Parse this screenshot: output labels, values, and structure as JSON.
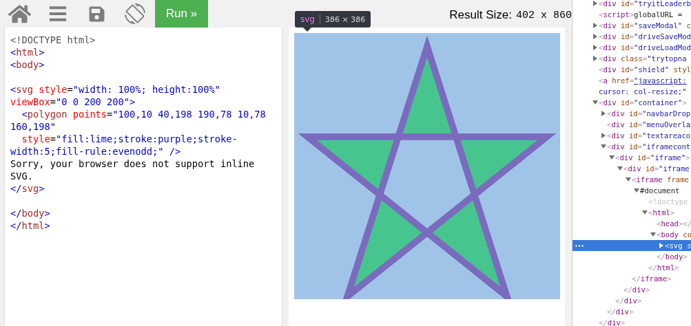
{
  "toolbar": {
    "run_button": "Run »",
    "result_size_label": "Result Size:",
    "result_size_value": "402 x 860"
  },
  "editor": {
    "lines": [
      {
        "kind": "code",
        "tokens": [
          {
            "kind": "doctype",
            "text": "<!DOCTYPE html>"
          }
        ]
      },
      {
        "kind": "code",
        "tokens": [
          {
            "kind": "punct",
            "text": "<"
          },
          {
            "kind": "tag",
            "text": "html"
          },
          {
            "kind": "punct",
            "text": ">"
          }
        ]
      },
      {
        "kind": "code",
        "tokens": [
          {
            "kind": "punct",
            "text": "<"
          },
          {
            "kind": "tag",
            "text": "body"
          },
          {
            "kind": "punct",
            "text": ">"
          }
        ]
      },
      {
        "kind": "blank"
      },
      {
        "kind": "code",
        "tokens": [
          {
            "kind": "punct",
            "text": "<"
          },
          {
            "kind": "tag",
            "text": "svg"
          },
          {
            "kind": "attr",
            "text": " style"
          },
          {
            "kind": "text",
            "text": "="
          },
          {
            "kind": "value",
            "text": "\"width: 100%; height:100%\""
          }
        ]
      },
      {
        "kind": "code",
        "tokens": [
          {
            "kind": "attr",
            "text": "viewBox"
          },
          {
            "kind": "text",
            "text": "="
          },
          {
            "kind": "value",
            "text": "\"0 0 200 200\""
          },
          {
            "kind": "punct",
            "text": ">"
          }
        ]
      },
      {
        "kind": "code",
        "tokens": [
          {
            "kind": "punct",
            "text": "  <"
          },
          {
            "kind": "tag",
            "text": "polygon"
          },
          {
            "kind": "attr",
            "text": " points"
          },
          {
            "kind": "text",
            "text": "="
          },
          {
            "kind": "value",
            "text": "\"100,10 40,198 190,78 10,78"
          }
        ]
      },
      {
        "kind": "code",
        "tokens": [
          {
            "kind": "value",
            "text": "160,198\""
          }
        ]
      },
      {
        "kind": "code",
        "tokens": [
          {
            "kind": "attr",
            "text": "  style"
          },
          {
            "kind": "text",
            "text": "="
          },
          {
            "kind": "value",
            "text": "\"fill:lime;stroke:purple;stroke-"
          }
        ]
      },
      {
        "kind": "code",
        "tokens": [
          {
            "kind": "value",
            "text": "width:5;fill-rule:evenodd;\""
          },
          {
            "kind": "punct",
            "text": " />"
          }
        ]
      },
      {
        "kind": "code",
        "tokens": [
          {
            "kind": "text",
            "text": "Sorry, your browser does not support inline"
          }
        ]
      },
      {
        "kind": "code",
        "tokens": [
          {
            "kind": "text",
            "text": "SVG."
          }
        ]
      },
      {
        "kind": "code",
        "tokens": [
          {
            "kind": "punct",
            "text": "</"
          },
          {
            "kind": "tag",
            "text": "svg"
          },
          {
            "kind": "punct",
            "text": ">"
          }
        ]
      },
      {
        "kind": "blank"
      },
      {
        "kind": "code",
        "tokens": [
          {
            "kind": "punct",
            "text": "</"
          },
          {
            "kind": "tag",
            "text": "body"
          },
          {
            "kind": "punct",
            "text": ">"
          }
        ]
      },
      {
        "kind": "code",
        "tokens": [
          {
            "kind": "punct",
            "text": "</"
          },
          {
            "kind": "tag",
            "text": "html"
          },
          {
            "kind": "punct",
            "text": ">"
          }
        ]
      }
    ]
  },
  "tooltip": {
    "tag": "svg",
    "size": "386 × 386"
  },
  "devtools": {
    "nodes": [
      {
        "selected": false,
        "expanded": false,
        "tokens": [
          {
            "kind": "punct",
            "text": "<"
          },
          {
            "kind": "tag",
            "text": "div"
          },
          {
            "kind": "attr",
            "text": " id"
          },
          {
            "kind": "punct",
            "text": "="
          },
          {
            "kind": "value",
            "text": "\"tryitLeaderb"
          }
        ]
      },
      {
        "selected": false,
        "tokens": [
          {
            "kind": "punct",
            "text": "<"
          },
          {
            "kind": "tag",
            "text": "script"
          },
          {
            "kind": "punct",
            "text": ">"
          },
          {
            "kind": "text",
            "text": "globalURL ="
          }
        ]
      },
      {
        "selected": false,
        "expanded": false,
        "tokens": [
          {
            "kind": "punct",
            "text": "<"
          },
          {
            "kind": "tag",
            "text": "div"
          },
          {
            "kind": "attr",
            "text": " id"
          },
          {
            "kind": "punct",
            "text": "="
          },
          {
            "kind": "value",
            "text": "\"saveModal\""
          },
          {
            "kind": "attr",
            "text": " c"
          }
        ]
      },
      {
        "selected": false,
        "expanded": false,
        "tokens": [
          {
            "kind": "punct",
            "text": "<"
          },
          {
            "kind": "tag",
            "text": "div"
          },
          {
            "kind": "attr",
            "text": " id"
          },
          {
            "kind": "punct",
            "text": "="
          },
          {
            "kind": "value",
            "text": "\"driveSaveMod"
          }
        ]
      },
      {
        "selected": false,
        "expanded": false,
        "tokens": [
          {
            "kind": "punct",
            "text": "<"
          },
          {
            "kind": "tag",
            "text": "div"
          },
          {
            "kind": "attr",
            "text": " id"
          },
          {
            "kind": "punct",
            "text": "="
          },
          {
            "kind": "value",
            "text": "\"driveLoadMod"
          }
        ]
      },
      {
        "selected": false,
        "expanded": false,
        "tokens": [
          {
            "kind": "punct",
            "text": "<"
          },
          {
            "kind": "tag",
            "text": "div"
          },
          {
            "kind": "attr",
            "text": " class"
          },
          {
            "kind": "punct",
            "text": "="
          },
          {
            "kind": "value",
            "text": "\"trytopna"
          }
        ]
      },
      {
        "selected": false,
        "tokens": [
          {
            "kind": "punct",
            "text": "<"
          },
          {
            "kind": "tag",
            "text": "div"
          },
          {
            "kind": "attr",
            "text": " id"
          },
          {
            "kind": "punct",
            "text": "="
          },
          {
            "kind": "value",
            "text": "\"shield\""
          },
          {
            "kind": "attr",
            "text": " styl"
          }
        ]
      },
      {
        "selected": false,
        "tokens": [
          {
            "kind": "punct",
            "text": "<"
          },
          {
            "kind": "tag",
            "text": "a"
          },
          {
            "kind": "attr",
            "text": " href"
          },
          {
            "kind": "punct",
            "text": "="
          },
          {
            "kind": "link",
            "text": "\"javascript:"
          }
        ]
      },
      {
        "selected": false,
        "tokens": [
          {
            "kind": "value",
            "text": "cursor: col-resize;\""
          }
        ]
      },
      {
        "selected": false,
        "expanded": true,
        "tokens": [
          {
            "kind": "punct",
            "text": "<"
          },
          {
            "kind": "tag",
            "text": "div"
          },
          {
            "kind": "attr",
            "text": " id"
          },
          {
            "kind": "punct",
            "text": "="
          },
          {
            "kind": "value",
            "text": "\"container\""
          },
          {
            "kind": "punct",
            "text": ">"
          }
        ],
        "close": [
          {
            "kind": "punct",
            "text": "</"
          },
          {
            "kind": "tag",
            "text": "div"
          },
          {
            "kind": "punct",
            "text": ">"
          }
        ],
        "children": [
          {
            "selected": false,
            "expanded": false,
            "tokens": [
              {
                "kind": "punct",
                "text": "<"
              },
              {
                "kind": "tag",
                "text": "div"
              },
              {
                "kind": "attr",
                "text": " id"
              },
              {
                "kind": "punct",
                "text": "="
              },
              {
                "kind": "value",
                "text": "\"navbarDrop"
              }
            ]
          },
          {
            "selected": false,
            "tokens": [
              {
                "kind": "punct",
                "text": "<"
              },
              {
                "kind": "tag",
                "text": "div"
              },
              {
                "kind": "attr",
                "text": " id"
              },
              {
                "kind": "punct",
                "text": "="
              },
              {
                "kind": "value",
                "text": "\"menuOverla"
              }
            ]
          },
          {
            "selected": false,
            "expanded": false,
            "tokens": [
              {
                "kind": "punct",
                "text": "<"
              },
              {
                "kind": "tag",
                "text": "div"
              },
              {
                "kind": "attr",
                "text": " id"
              },
              {
                "kind": "punct",
                "text": "="
              },
              {
                "kind": "value",
                "text": "\"textareaco"
              }
            ]
          },
          {
            "selected": false,
            "expanded": true,
            "tokens": [
              {
                "kind": "punct",
                "text": "<"
              },
              {
                "kind": "tag",
                "text": "div"
              },
              {
                "kind": "attr",
                "text": " id"
              },
              {
                "kind": "punct",
                "text": "="
              },
              {
                "kind": "value",
                "text": "\"iframecont"
              }
            ],
            "close": [
              {
                "kind": "punct",
                "text": "</"
              },
              {
                "kind": "tag",
                "text": "div"
              },
              {
                "kind": "punct",
                "text": ">"
              }
            ],
            "children": [
              {
                "selected": false,
                "expanded": true,
                "tokens": [
                  {
                    "kind": "punct",
                    "text": "<"
                  },
                  {
                    "kind": "tag",
                    "text": "div"
                  },
                  {
                    "kind": "attr",
                    "text": " id"
                  },
                  {
                    "kind": "punct",
                    "text": "="
                  },
                  {
                    "kind": "value",
                    "text": "\"iframe\""
                  },
                  {
                    "kind": "punct",
                    "text": ">"
                  }
                ],
                "close": [
                  {
                    "kind": "punct",
                    "text": "</"
                  },
                  {
                    "kind": "tag",
                    "text": "div"
                  },
                  {
                    "kind": "punct",
                    "text": ">"
                  }
                ],
                "children": [
                  {
                    "selected": false,
                    "expanded": true,
                    "tokens": [
                      {
                        "kind": "punct",
                        "text": "<"
                      },
                      {
                        "kind": "tag",
                        "text": "div"
                      },
                      {
                        "kind": "attr",
                        "text": " id"
                      },
                      {
                        "kind": "punct",
                        "text": "="
                      },
                      {
                        "kind": "value",
                        "text": "\"iframe"
                      }
                    ],
                    "close": [
                      {
                        "kind": "punct",
                        "text": "</"
                      },
                      {
                        "kind": "tag",
                        "text": "div"
                      },
                      {
                        "kind": "punct",
                        "text": ">"
                      }
                    ],
                    "children": [
                      {
                        "selected": false,
                        "expanded": true,
                        "tokens": [
                          {
                            "kind": "punct",
                            "text": "<"
                          },
                          {
                            "kind": "tag",
                            "text": "iframe"
                          },
                          {
                            "kind": "attr",
                            "text": " frame"
                          }
                        ],
                        "close": [
                          {
                            "kind": "punct",
                            "text": "</"
                          },
                          {
                            "kind": "tag",
                            "text": "iframe"
                          },
                          {
                            "kind": "punct",
                            "text": ">"
                          }
                        ],
                        "children": [
                          {
                            "selected": false,
                            "expanded": true,
                            "tokens": [
                              {
                                "kind": "text",
                                "text": "#document"
                              }
                            ],
                            "children": [
                              {
                                "selected": false,
                                "tokens": [
                                  {
                                    "kind": "doctype",
                                    "text": "<!doctype"
                                  }
                                ]
                              },
                              {
                                "selected": false,
                                "expanded": true,
                                "tokens": [
                                  {
                                    "kind": "punct",
                                    "text": "<"
                                  },
                                  {
                                    "kind": "tag",
                                    "text": "html"
                                  },
                                  {
                                    "kind": "punct",
                                    "text": ">"
                                  }
                                ],
                                "close": [
                                  {
                                    "kind": "punct",
                                    "text": "</"
                                  },
                                  {
                                    "kind": "tag",
                                    "text": "html"
                                  },
                                  {
                                    "kind": "punct",
                                    "text": ">"
                                  }
                                ],
                                "children": [
                                  {
                                    "selected": false,
                                    "tokens": [
                                      {
                                        "kind": "punct",
                                        "text": "<"
                                      },
                                      {
                                        "kind": "tag",
                                        "text": "head"
                                      },
                                      {
                                        "kind": "punct",
                                        "text": "></"
                                      }
                                    ]
                                  },
                                  {
                                    "selected": false,
                                    "expanded": true,
                                    "tokens": [
                                      {
                                        "kind": "punct",
                                        "text": "<"
                                      },
                                      {
                                        "kind": "tag",
                                        "text": "body"
                                      },
                                      {
                                        "kind": "attr",
                                        "text": " co"
                                      }
                                    ],
                                    "close": [
                                      {
                                        "kind": "punct",
                                        "text": "</"
                                      },
                                      {
                                        "kind": "tag",
                                        "text": "body"
                                      },
                                      {
                                        "kind": "punct",
                                        "text": ">"
                                      }
                                    ],
                                    "children": [
                                      {
                                        "selected": true,
                                        "expanded": false,
                                        "tokens": [
                                          {
                                            "kind": "punct",
                                            "text": "<"
                                          },
                                          {
                                            "kind": "tag",
                                            "text": "svg"
                                          },
                                          {
                                            "kind": "attr",
                                            "text": " s"
                                          }
                                        ]
                                      }
                                    ]
                                  }
                                ]
                              }
                            ]
                          }
                        ]
                      }
                    ]
                  }
                ]
              }
            ]
          }
        ]
      }
    ]
  }
}
